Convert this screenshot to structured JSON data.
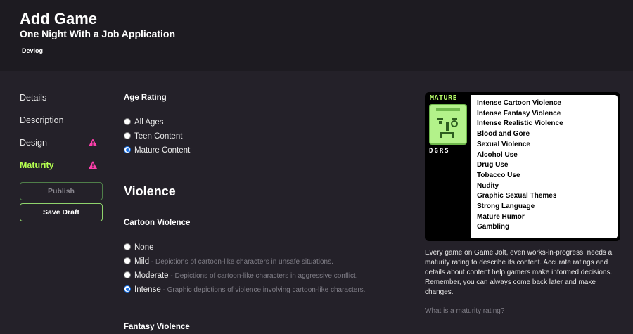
{
  "header": {
    "title": "Add Game",
    "subtitle": "One Night With a Job Application",
    "tab": "Devlog"
  },
  "sidebar": {
    "items": [
      {
        "label": "Details"
      },
      {
        "label": "Description"
      },
      {
        "label": "Design"
      },
      {
        "label": "Maturity"
      }
    ],
    "publish_label": "Publish",
    "save_draft_label": "Save Draft"
  },
  "age_rating": {
    "label": "Age Rating",
    "options": [
      "All Ages",
      "Teen Content",
      "Mature Content"
    ],
    "selected": "Mature Content"
  },
  "violence": {
    "heading": "Violence",
    "cartoon": {
      "label": "Cartoon Violence",
      "options": [
        {
          "label": "None",
          "desc": ""
        },
        {
          "label": "Mild",
          "desc": " - Depictions of cartoon-like characters in unsafe situations."
        },
        {
          "label": "Moderate",
          "desc": " - Depictions of cartoon-like characters in aggressive conflict."
        },
        {
          "label": "Intense",
          "desc": " - Graphic depictions of violence involving cartoon-like characters."
        }
      ],
      "selected": "Intense"
    },
    "fantasy_label": "Fantasy Violence"
  },
  "rating_card": {
    "badge": "MATURE",
    "org": "DGRS",
    "descriptors": [
      "Intense Cartoon Violence",
      "Intense Fantasy Violence",
      "Intense Realistic Violence",
      "Blood and Gore",
      "Sexual Violence",
      "Alcohol Use",
      "Drug Use",
      "Tobacco Use",
      "Nudity",
      "Graphic Sexual Themes",
      "Strong Language",
      "Mature Humor",
      "Gambling"
    ]
  },
  "info": {
    "text": "Every game on Game Jolt, even works-in-progress, needs a maturity rating to describe its content. Accurate ratings and details about content help gamers make informed decisions. Remember, you can always come back later and make changes.",
    "link": "What is a maturity rating?"
  },
  "colors": {
    "background": "#242129",
    "header": "#1d1b21",
    "accent": "#b5ff4f",
    "warning": "#ff3fac"
  }
}
